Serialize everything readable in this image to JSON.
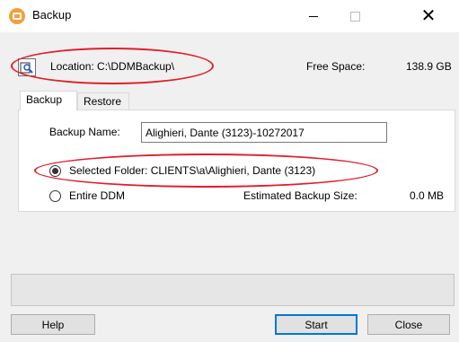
{
  "window": {
    "title": "Backup",
    "accent_icon_color": "#f2a03d"
  },
  "location": {
    "label": "Location:",
    "path": "C:\\DDMBackup\\",
    "free_space_label": "Free Space:",
    "free_space_value": "138.9 GB"
  },
  "tabs": [
    {
      "label": "Backup",
      "active": true
    },
    {
      "label": "Restore",
      "active": false
    }
  ],
  "backup": {
    "name_label": "Backup Name:",
    "name_value": "Alighieri, Dante (3123)-10272017",
    "option_selected_label": "Selected Folder: CLIENTS\\a\\Alighieri, Dante (3123)",
    "option_entire_label": "Entire DDM",
    "estimated_label": "Estimated Backup Size:",
    "estimated_value": "0.0 MB"
  },
  "buttons": {
    "help": "Help",
    "start": "Start",
    "close": "Close"
  },
  "annotation_color": "#e01f2d"
}
